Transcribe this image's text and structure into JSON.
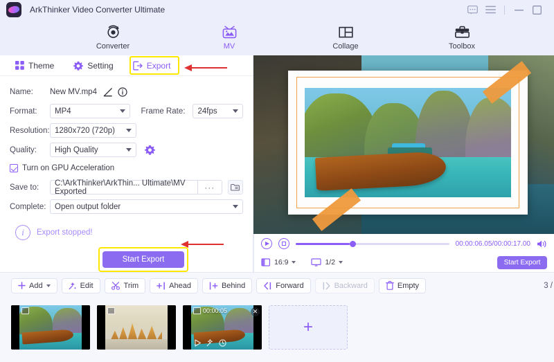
{
  "window": {
    "app_title": "ArkThinker Video Converter Ultimate",
    "controls": {
      "feedback": "feedback-icon",
      "menu": "menu-icon",
      "minimize": "minimize-icon",
      "maximize": "maximize-icon"
    }
  },
  "main_nav": {
    "items": [
      {
        "label": "Converter",
        "icon": "converter-icon",
        "active": false
      },
      {
        "label": "MV",
        "icon": "mv-icon",
        "active": true
      },
      {
        "label": "Collage",
        "icon": "collage-icon",
        "active": false
      },
      {
        "label": "Toolbox",
        "icon": "toolbox-icon",
        "active": false
      }
    ]
  },
  "panel_tabs": {
    "items": [
      {
        "label": "Theme",
        "icon": "grid-icon"
      },
      {
        "label": "Setting",
        "icon": "gear-icon"
      },
      {
        "label": "Export",
        "icon": "export-icon"
      }
    ],
    "active": "Export"
  },
  "export_form": {
    "name_label": "Name:",
    "name_value": "New MV.mp4",
    "format_label": "Format:",
    "format_value": "MP4",
    "frame_rate_label": "Frame Rate:",
    "frame_rate_value": "24fps",
    "resolution_label": "Resolution:",
    "resolution_value": "1280x720 (720p)",
    "quality_label": "Quality:",
    "quality_value": "High Quality",
    "gpu_label": "Turn on GPU Acceleration",
    "gpu_checked": true,
    "save_to_label": "Save to:",
    "save_to_value": "C:\\ArkThinker\\ArkThin... Ultimate\\MV Exported",
    "browse_dots": "···",
    "complete_label": "Complete:",
    "complete_value": "Open output folder",
    "status_text": "Export stopped!",
    "start_export_label": "Start Export"
  },
  "player": {
    "current_time": "00:00:06.05",
    "total_time": "00:00:17.00",
    "timecode": "00:00:06.05/00:00:17.00",
    "aspect_ratio": "16:9",
    "scale": "1/2",
    "start_export_label": "Start Export",
    "progress_percent": 35
  },
  "toolbar": {
    "buttons": [
      {
        "label": "Add",
        "icon": "plus-icon",
        "disabled": false,
        "has_caret": true
      },
      {
        "label": "Edit",
        "icon": "magic-wand-icon",
        "disabled": false,
        "has_caret": false
      },
      {
        "label": "Trim",
        "icon": "scissors-icon",
        "disabled": false,
        "has_caret": false
      },
      {
        "label": "Ahead",
        "icon": "insert-ahead-icon",
        "disabled": false,
        "has_caret": false
      },
      {
        "label": "Behind",
        "icon": "insert-behind-icon",
        "disabled": false,
        "has_caret": false
      },
      {
        "label": "Forward",
        "icon": "move-forward-icon",
        "disabled": false,
        "has_caret": false
      },
      {
        "label": "Backward",
        "icon": "move-backward-icon",
        "disabled": true,
        "has_caret": false
      },
      {
        "label": "Empty",
        "icon": "trash-icon",
        "disabled": false,
        "has_caret": false
      }
    ],
    "counter": "3 /"
  },
  "thumbnails": {
    "items": [
      {
        "name": "clip-1",
        "selected": false,
        "duration": "",
        "style": "beach"
      },
      {
        "name": "clip-2",
        "selected": false,
        "duration": "",
        "style": "temple"
      },
      {
        "name": "clip-3",
        "selected": true,
        "duration": "00:00:05",
        "style": "beach"
      }
    ],
    "add_tile_label": "+"
  },
  "colors": {
    "accent": "#8b5cf6",
    "button": "#8b6cf0",
    "highlight": "#ffe800",
    "arrow": "#e03131",
    "titlebar_bg": "#eceefb",
    "panel_bg": "#f6f7fd",
    "tape": "#ef9a3d"
  }
}
